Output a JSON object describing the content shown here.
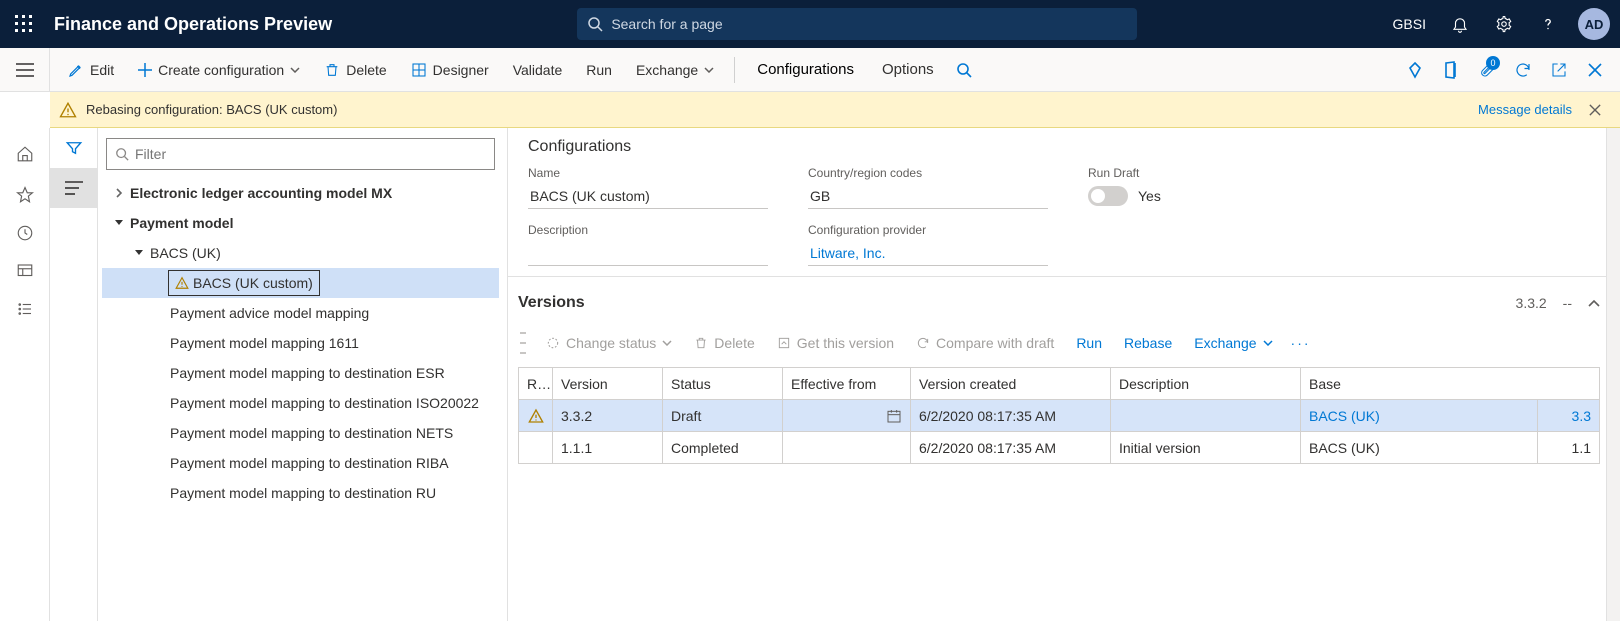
{
  "top": {
    "app_title": "Finance and Operations Preview",
    "search_placeholder": "Search for a page",
    "company": "GBSI",
    "avatar": "AD"
  },
  "cmd": {
    "edit": "Edit",
    "create_config": "Create configuration",
    "delete": "Delete",
    "designer": "Designer",
    "validate": "Validate",
    "run": "Run",
    "exchange": "Exchange",
    "tab_config": "Configurations",
    "tab_options": "Options",
    "paperclip_badge": "0"
  },
  "msg": {
    "text": "Rebasing configuration: BACS (UK custom)",
    "details": "Message details"
  },
  "filter": {
    "placeholder": "Filter"
  },
  "tree": {
    "n0": "Electronic ledger accounting model MX",
    "n1": "Payment model",
    "n2": "BACS (UK)",
    "n3": "BACS (UK custom)",
    "n4": "Payment advice model mapping",
    "n5": "Payment model mapping 1611",
    "n6": "Payment model mapping to destination ESR",
    "n7": "Payment model mapping to destination ISO20022",
    "n8": "Payment model mapping to destination NETS",
    "n9": "Payment model mapping to destination RIBA",
    "n10": "Payment model mapping to destination RU"
  },
  "details": {
    "heading": "Configurations",
    "name_label": "Name",
    "name_value": "BACS (UK custom)",
    "country_label": "Country/region codes",
    "country_value": "GB",
    "rundraft_label": "Run Draft",
    "rundraft_value": "Yes",
    "desc_label": "Description",
    "prov_label": "Configuration provider",
    "prov_value": "Litware, Inc."
  },
  "versions": {
    "heading": "Versions",
    "current": "3.3.2",
    "dashdash": "--",
    "tb": {
      "change_status": "Change status",
      "delete": "Delete",
      "get": "Get this version",
      "compare": "Compare with draft",
      "run": "Run",
      "rebase": "Rebase",
      "exchange": "Exchange"
    },
    "cols": {
      "r": "R…",
      "ver": "Version",
      "status": "Status",
      "eff": "Effective from",
      "created": "Version created",
      "desc": "Description",
      "base": "Base"
    },
    "rows": [
      {
        "warn": true,
        "ver": "3.3.2",
        "status": "Draft",
        "created": "6/2/2020 08:17:35 AM",
        "desc": "",
        "base": "BACS (UK)",
        "basev": "3.3",
        "sel": true,
        "link": true
      },
      {
        "warn": false,
        "ver": "1.1.1",
        "status": "Completed",
        "created": "6/2/2020 08:17:35 AM",
        "desc": "Initial version",
        "base": "BACS (UK)",
        "basev": "1.1",
        "sel": false,
        "link": false
      }
    ]
  }
}
